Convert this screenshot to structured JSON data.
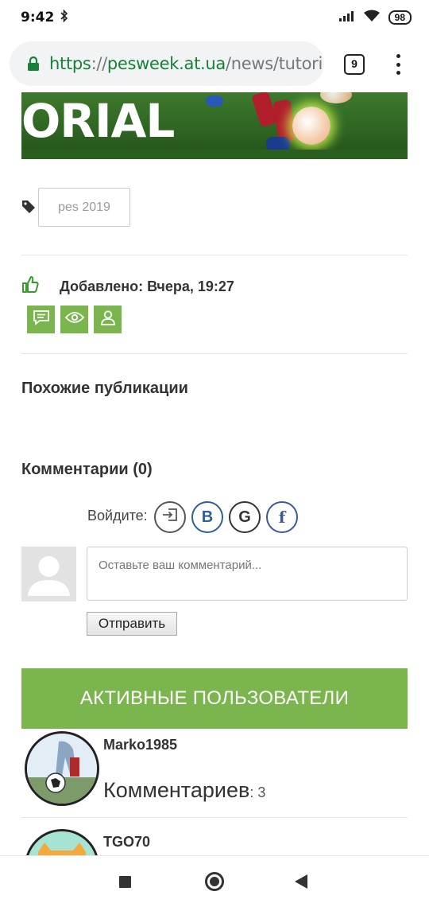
{
  "status_bar": {
    "time": "9:42",
    "battery": "98"
  },
  "browser": {
    "url_scheme": "https",
    "url_sep": "://",
    "url_host": "pesweek.at.ua",
    "url_path": "/news/tutori",
    "tab_count": "9"
  },
  "banner": {
    "text": "ORIAL"
  },
  "tags": [
    "pes 2019"
  ],
  "post": {
    "added": "Добавлено: Вчера, 19:27"
  },
  "similar": {
    "title": "Похожие публикации"
  },
  "comments": {
    "title": "Комментарии (0)",
    "login_label": "Войдите:",
    "vk_label": "B",
    "google_label": "G",
    "facebook_label": "f",
    "placeholder": "Оставьте ваш комментарий...",
    "submit": "Отправить"
  },
  "active_users": {
    "title": "АКТИВНЫЕ ПОЛЬЗОВАТЕЛИ",
    "users": [
      {
        "name": "Marko1985",
        "comments_label": "Комментариев",
        "comments_count": ": 3"
      },
      {
        "name": "TGO70"
      }
    ]
  },
  "colors": {
    "accent_green": "#7bb54e",
    "url_green": "#188038",
    "vk_blue": "#2e5f97",
    "fb_blue": "#3b5998"
  }
}
